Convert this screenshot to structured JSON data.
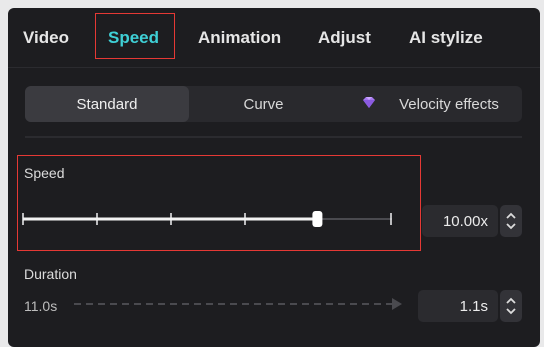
{
  "tabs": [
    {
      "label": "Video"
    },
    {
      "label": "Speed"
    },
    {
      "label": "Animation"
    },
    {
      "label": "Adjust"
    },
    {
      "label": "AI stylize"
    }
  ],
  "modes": {
    "standard": "Standard",
    "curve": "Curve",
    "velocity": "Velocity effects"
  },
  "speed": {
    "label": "Speed",
    "value": "10.00x",
    "level": 0.8
  },
  "duration": {
    "label": "Duration",
    "original": "11.0s",
    "value": "1.1s"
  },
  "colors": {
    "accent": "#3fd0d6",
    "highlight": "#e53935",
    "gem": "#a678f0"
  },
  "icons": {
    "velocity": "diamond-icon",
    "stepper": "up-down-chevron-icon",
    "duration_arrow": "arrow-right-icon"
  }
}
